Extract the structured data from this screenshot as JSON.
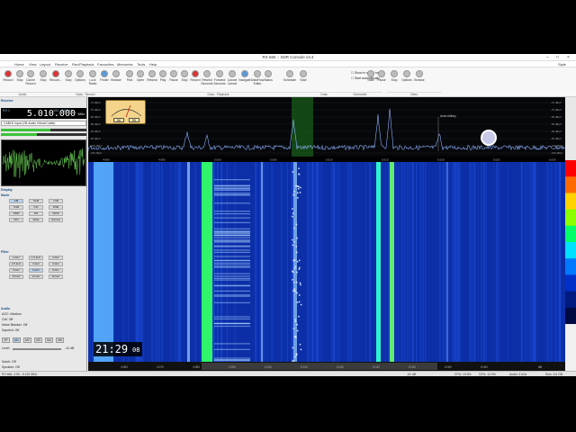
{
  "window": {
    "title": "RX 666 :: SDR Console v3.4"
  },
  "menu": [
    "Home",
    "View",
    "Layout",
    "Receive",
    "Rec/Playback",
    "Favourites",
    "Memories",
    "Tools",
    "Help"
  ],
  "style_label": "Style",
  "ribbon": {
    "buttons": [
      {
        "id": "record",
        "label": "Record"
      },
      {
        "id": "stop",
        "label": "Stop"
      },
      {
        "id": "cache-record",
        "label": "Cache Record"
      },
      {
        "id": "stop2",
        "label": "Stop"
      },
      {
        "id": "record2",
        "label": "Record..."
      },
      {
        "id": "stop3",
        "label": "Stop"
      },
      {
        "id": "options",
        "label": "Options"
      },
      {
        "id": "lock-radio",
        "label": "Lock Radio"
      },
      {
        "id": "finder",
        "label": "Finder"
      },
      {
        "id": "browse",
        "label": "Browse"
      },
      {
        "id": "find",
        "label": "Find"
      },
      {
        "id": "open",
        "label": "Open"
      },
      {
        "id": "rewind",
        "label": "Rewind"
      },
      {
        "id": "play",
        "label": "Play"
      },
      {
        "id": "pause",
        "label": "Pause"
      },
      {
        "id": "stop4",
        "label": "Stop"
      },
      {
        "id": "record3",
        "label": "Record"
      },
      {
        "id": "rewind-seconds",
        "label": "Rewind Seconds"
      },
      {
        "id": "forward-seconds",
        "label": "Forward Seconds"
      },
      {
        "id": "cancel-cancel",
        "label": "Cancel Cancel"
      },
      {
        "id": "navigate",
        "label": "Navigate"
      },
      {
        "id": "dataflow-editor",
        "label": "DataFlow Editor"
      },
      {
        "id": "status",
        "label": "Status"
      },
      {
        "id": "schedule",
        "label": "Schedule"
      },
      {
        "id": "start",
        "label": "Start"
      },
      {
        "id": "start-v",
        "label": "Start"
      },
      {
        "id": "pause-v",
        "label": "Pause"
      },
      {
        "id": "stop-v",
        "label": "Stop"
      },
      {
        "id": "options-v",
        "label": "Options"
      },
      {
        "id": "browse-v",
        "label": "Browse"
      }
    ],
    "check_show_status": "Show in status bar",
    "check_start_auto": "Start automatically",
    "groups": [
      "Audio",
      "Data - Record",
      "Data - Playback",
      "Data",
      "Scheduler",
      "Video"
    ]
  },
  "receive": {
    "header": "Receive",
    "rx": "RX 1",
    "range": "100 - 3100 Hz",
    "frequency": "5.010.000",
    "unit": "MHz",
    "device": "CABLE Input (VB-Audio Virtual Cable)",
    "display_header": "Display",
    "mode_header": "Mode",
    "modes": [
      "AM",
      "SAM",
      "LSB",
      "USB",
      "CW",
      "DSB",
      "DRM",
      "FM",
      "WFM",
      "DIG",
      "Wide",
      "Narrow"
    ],
    "filter_header": "Filter",
    "filters": [
      "1 kHz",
      "1.5 kHz",
      "2 kHz",
      "2.5 kHz",
      "3 kHz",
      "4 kHz",
      "5 kHz",
      "6 kHz",
      "8 kHz",
      "10 kHz",
      "12 kHz",
      "16 kHz"
    ],
    "audio_header": "Audio",
    "agc": "AGC: Medium",
    "cw": "CW: Off",
    "noise_blanker": "Noise Blanker: Off",
    "squelch": "Squelch: Off",
    "mem_buttons": [
      "SP",
      "M1",
      "M2",
      "M3",
      "M4",
      "M5"
    ],
    "volume_label": "Level",
    "volume_db": "-10 dB",
    "notch": "Notch: Off",
    "speaker": "Speaker: Off"
  },
  "smeter": {
    "left": "S6",
    "right": "S9"
  },
  "spectrum": {
    "db_labels": [
      "-70 dBµV",
      "-75 dBµV",
      "-80 dBµV",
      "-85 dBµV",
      "-90 dBµV",
      "-95 dBµV",
      "-100 dBµV",
      "-105 dBµV"
    ],
    "axis_labels": [
      "4.990",
      "4.995",
      "5.000",
      "5.005",
      "5.010",
      "5.015",
      "5.020",
      "5.025",
      "5.030"
    ],
    "marker": "Arab military"
  },
  "waterfall": {
    "scale_labels": [
      "4.960",
      "4.970",
      "4.980",
      "4.990",
      "5.000",
      "5.010",
      "5.020",
      "5.030",
      "5.040",
      "5.050",
      "5.060"
    ],
    "zoom": "40",
    "colors": [
      "#ff0000",
      "#ff6a00",
      "#ffd200",
      "#8cff00",
      "#00ff6a",
      "#00e0ff",
      "#0078ff",
      "#0030c8",
      "#001a80",
      "#000a40"
    ]
  },
  "clock": {
    "hm": "21:29",
    "ss": "08"
  },
  "status": {
    "left": "RX 666, 4.90 - 5.120 MHz",
    "audio": "-62 dB",
    "cpu": "CPU: 19.6%",
    "gpu": "GPU: 12.9%",
    "audio_rate": "Audio: 4 kHz",
    "size": "Size: 3.6 GB"
  }
}
